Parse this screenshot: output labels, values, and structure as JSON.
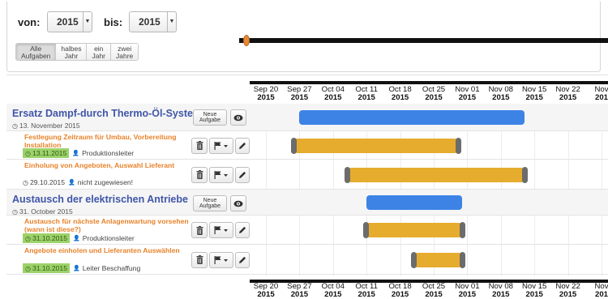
{
  "filter": {
    "from_label": "von:",
    "from_year": "2015",
    "to_label": "bis:",
    "to_year": "2015",
    "ranges": [
      {
        "line1": "Alle",
        "line2": "Aufgaben",
        "active": true
      },
      {
        "line1": "halbes",
        "line2": "Jahr",
        "active": false
      },
      {
        "line1": "ein",
        "line2": "Jahr",
        "active": false
      },
      {
        "line1": "zwei",
        "line2": "Jahre",
        "active": false
      }
    ]
  },
  "timeline": {
    "ticks": [
      {
        "label": "Sep 20",
        "year": "2015"
      },
      {
        "label": "Sep 27",
        "year": "2015"
      },
      {
        "label": "Oct 04",
        "year": "2015"
      },
      {
        "label": "Oct 11",
        "year": "2015"
      },
      {
        "label": "Oct 18",
        "year": "2015"
      },
      {
        "label": "Oct 25",
        "year": "2015"
      },
      {
        "label": "Nov 01",
        "year": "2015"
      },
      {
        "label": "Nov 08",
        "year": "2015"
      },
      {
        "label": "Nov 15",
        "year": "2015"
      },
      {
        "label": "Nov 22",
        "year": "2015"
      },
      {
        "label": "Nov",
        "year": "201"
      }
    ]
  },
  "projects": [
    {
      "title": "Ersatz Dampf-durch Thermo-Öl-System",
      "date": "13. November 2015",
      "new_task_label": "Neue Aufgabe",
      "start": "2015-09-27",
      "end": "2015-11-13",
      "tasks": [
        {
          "title": "Festlegung Zeitraum für Umbau, Vorbereitung Installation",
          "date": "13.11.2015",
          "date_highlight": true,
          "assignee": "Produktionsleiter",
          "start": "2015-09-26",
          "end": "2015-10-30"
        },
        {
          "title": "Einholung von Angeboten, Auswahl Lieferant",
          "date": "29.10.2015",
          "date_highlight": false,
          "assignee": "nicht zugewiesen!",
          "start": "2015-10-07",
          "end": "2015-11-13"
        }
      ]
    },
    {
      "title": "Austausch der elektrischen Antriebe",
      "date": "31. October 2015",
      "new_task_label": "Neue Aufgabe",
      "start": "2015-10-11",
      "end": "2015-10-31",
      "tasks": [
        {
          "title": "Austausch für nächste Anlagenwartung vorsehen (wann ist diese?)",
          "date": "31.10.2015",
          "date_highlight": true,
          "assignee": "Produktionsleiter",
          "start": "2015-10-11",
          "end": "2015-10-31"
        },
        {
          "title": "Angebote einholen und Lieferanten Auswählen",
          "date": "31.10.2015",
          "date_highlight": true,
          "assignee": "Leiter Beschaffung",
          "start": "2015-10-21",
          "end": "2015-10-31"
        }
      ]
    }
  ],
  "colors": {
    "group_bar": "#3d83e5",
    "task_bar": "#e6ac2e",
    "group_title": "#3f56a8",
    "task_title": "#e8822a",
    "date_badge": "#9cd26a"
  }
}
